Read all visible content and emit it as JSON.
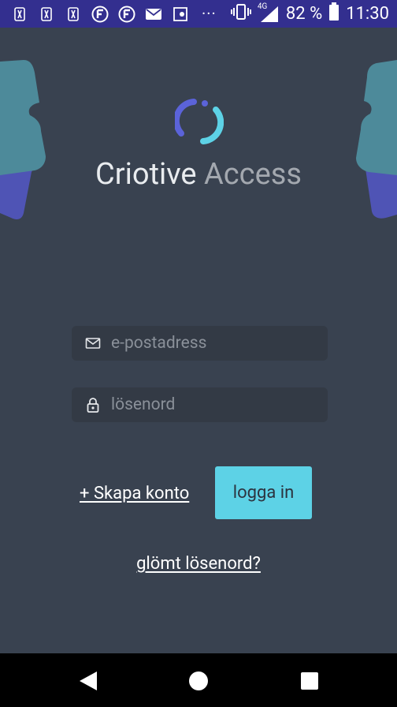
{
  "status_bar": {
    "battery_percent": "82 %",
    "time": "11:30",
    "network": "4G",
    "overflow": "···",
    "icons": [
      "golf-app-icon",
      "golf-app-icon",
      "golf-app-icon",
      "f-app-icon",
      "f-app-icon",
      "mail-icon",
      "location-icon",
      "overflow-dots",
      "vibrate-icon",
      "signal-icon",
      "battery-icon"
    ],
    "color": "#332f8f"
  },
  "brand": {
    "name_part1": "Criotive",
    "name_part2": "Access",
    "logo_color_1": "#5b63d9",
    "logo_color_2": "#5dd2e6"
  },
  "form": {
    "email": {
      "placeholder": "e-postadress",
      "value": "",
      "icon": "mail-icon"
    },
    "password": {
      "placeholder": "lösenord",
      "value": "",
      "icon": "lock-icon"
    }
  },
  "actions": {
    "create_account": "+ Skapa konto",
    "login": "logga in",
    "forgot_password": "glömt lösenord?"
  },
  "nav_bar": {
    "buttons": [
      "back-icon",
      "home-icon",
      "recents-icon"
    ]
  },
  "colors": {
    "background": "#394250",
    "accent": "#5dd2e6",
    "purple": "#5b63d9"
  }
}
